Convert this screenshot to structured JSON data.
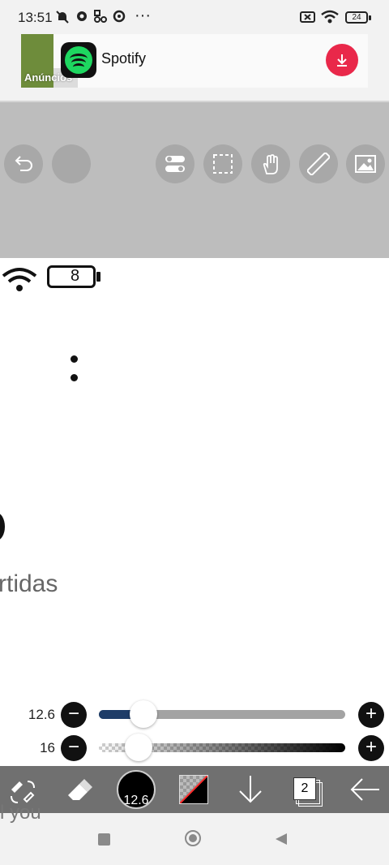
{
  "status_bar": {
    "time": "13:51",
    "more": "···",
    "battery": "24"
  },
  "ad": {
    "label": "Anúncios",
    "title": "Spotify",
    "accent": "#1ed760",
    "download_color": "#e9284a"
  },
  "canvas": {
    "visible_text": "rtidas",
    "battery_text": "8",
    "behind_text": "l you"
  },
  "sliders": {
    "brush_size": {
      "label": "12.6",
      "value_fraction": 0.18
    },
    "opacity": {
      "label": "16",
      "value_fraction": 0.16
    }
  },
  "bottom_toolbar": {
    "brush_size": "12.6",
    "layer_count": "2"
  },
  "colors": {
    "tool_area_bg": "#bdbdbd",
    "slider_fill": "#1f3d68",
    "bottom_toolbar_bg": "#707070"
  }
}
